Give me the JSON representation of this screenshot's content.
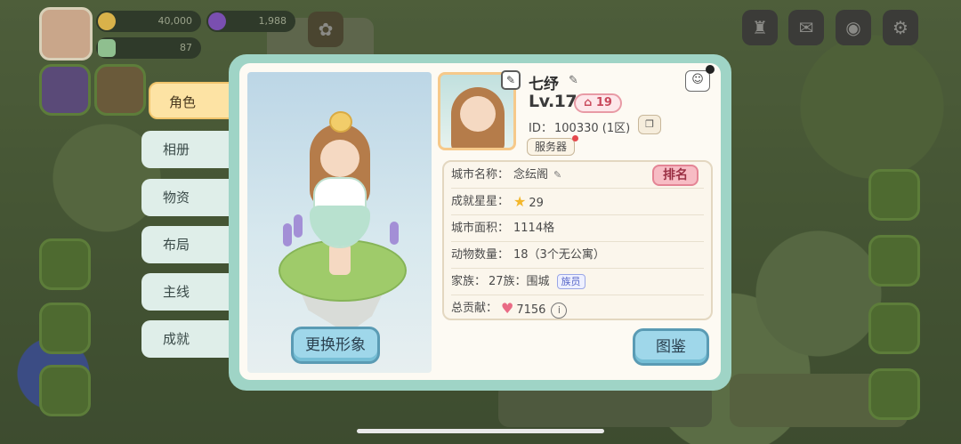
{
  "hud": {
    "coins": "40,000",
    "gems": "1,988",
    "energy": "87"
  },
  "tabs": [
    {
      "label": "角色",
      "active": true
    },
    {
      "label": "相册",
      "active": false
    },
    {
      "label": "物资",
      "active": false
    },
    {
      "label": "布局",
      "active": false
    },
    {
      "label": "主线",
      "active": false
    },
    {
      "label": "成就",
      "active": false
    }
  ],
  "profile": {
    "name": "七纾",
    "level": "Lv.17",
    "home_level": "19",
    "id_label": "ID：",
    "id_value": "100330 (1区)",
    "server_label": "服务器"
  },
  "info": {
    "city_name_label": "城市名称：",
    "city_name": "念纭阁",
    "rank_button": "排名",
    "stars_label": "成就星星：",
    "stars": "29",
    "area_label": "城市面积：",
    "area": "1114格",
    "animals_label": "动物数量：",
    "animals": "18（3个无公寓）",
    "clan_label": "家族：",
    "clan": "27族：围城",
    "clan_tag": "族员",
    "contribution_label": "总贡献：",
    "contribution": "7156"
  },
  "buttons": {
    "change_look": "更换形象",
    "atlas": "图鉴"
  },
  "icons": {
    "edit": "pencil-icon",
    "star": "star-icon",
    "heart": "heart-icon",
    "info": "info-icon"
  },
  "colors": {
    "modal_border": "#9fd4c6",
    "tab_active": "#fde3a4",
    "button_blue": "#9fd7ea",
    "rank_pink": "#f7bcc4"
  }
}
